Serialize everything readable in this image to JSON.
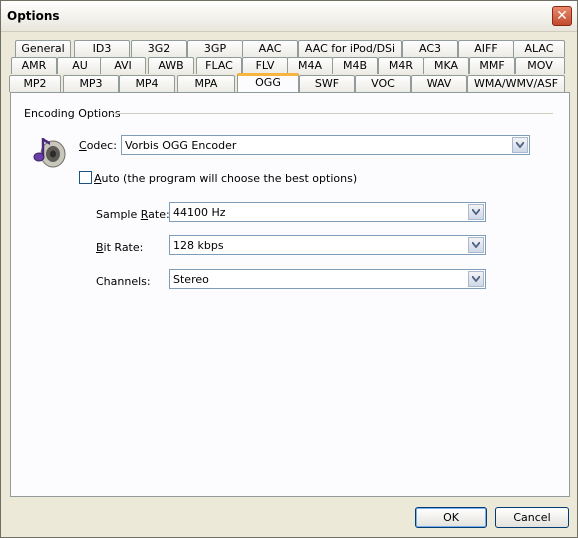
{
  "window": {
    "title": "Options",
    "close_label": "✕"
  },
  "tabs": {
    "row1": [
      "General",
      "ID3",
      "3G2",
      "3GP",
      "AAC",
      "AAC for iPod/DSi",
      "AC3",
      "AIFF",
      "ALAC"
    ],
    "row2": [
      "AMR",
      "AU",
      "AVI",
      "AWB",
      "FLAC",
      "FLV",
      "M4A",
      "M4B",
      "M4R",
      "MKA",
      "MMF",
      "MOV"
    ],
    "row3": [
      "MP2",
      "MP3",
      "MP4",
      "MPA",
      "OGG",
      "SWF",
      "VOC",
      "WAV",
      "WMA/WMV/ASF"
    ],
    "active": "OGG"
  },
  "encoding": {
    "group_title": "Encoding Options",
    "codec_label_u": "C",
    "codec_label_rest": "odec:",
    "codec_value": "Vorbis OGG Encoder",
    "auto_label_u": "A",
    "auto_label_rest": "uto (the program will choose the best options)",
    "auto_checked": false,
    "sample_rate_label_pre": "Sample ",
    "sample_rate_label_u": "R",
    "sample_rate_label_post": "ate:",
    "sample_rate_value": "44100 Hz",
    "bit_rate_label_u": "B",
    "bit_rate_label_rest": "it Rate:",
    "bit_rate_value": "128 kbps",
    "channels_label": "Channels:",
    "channels_value": "Stereo"
  },
  "buttons": {
    "ok": "OK",
    "cancel": "Cancel"
  }
}
